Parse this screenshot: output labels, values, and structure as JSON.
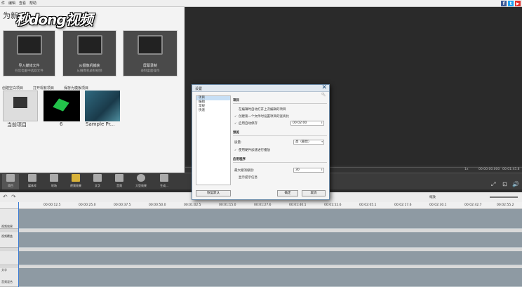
{
  "menubar": {
    "items": [
      "件",
      "编辑",
      "查看",
      "帮助"
    ]
  },
  "watermark": {
    "text": "秒dong视频"
  },
  "left_panel": {
    "title": "为新",
    "tiles": [
      {
        "line1": "导入媒体文件",
        "line2": "在您电脑中选取文件"
      },
      {
        "line1": "从摄像机捕获",
        "line2": "从摄像机录制视频"
      },
      {
        "line1": "屏幕录制",
        "line2": "录制桌面操作"
      }
    ],
    "links": [
      "创建空白项目",
      "打开现有项目",
      "保存为模板项目"
    ],
    "thumbs": [
      {
        "label": "当前项目"
      },
      {
        "label": "6"
      },
      {
        "label": "Sample Pr..."
      }
    ]
  },
  "preview": {
    "speed": "1x",
    "tc1": "00:00:00.000",
    "tc2": "00:01:45.8"
  },
  "toolbar": {
    "items": [
      "项目",
      "媒体库",
      "转场",
      "视频效果",
      "文字",
      "音频",
      "大型效果",
      "生成..."
    ]
  },
  "timeline": {
    "zoom_label": "缩放",
    "ruler": [
      "00:00:12.5",
      "00:00:25.0",
      "00:00:37.5",
      "00:00:50.0",
      "00:01:02.5",
      "00:01:15.0",
      "00:01:27.6",
      "00:01:40.1",
      "00:01:52.6",
      "00:02:05.1",
      "00:02:17.6",
      "00:02:30.1",
      "00:02:42.7",
      "00:02:55.2"
    ],
    "track_labels": [
      "视频效果",
      "视频覆盖",
      "",
      "文字",
      "音频混合"
    ]
  },
  "dialog": {
    "title": "设置",
    "close": "✕",
    "nav": [
      "项目",
      "编辑",
      "常规",
      "快速"
    ],
    "sections": {
      "project": "项目",
      "preview": "预览",
      "engine": "应用程序"
    },
    "rows": {
      "r1": "在编辑时自动打开上次编辑的项目",
      "r2": "创建第一个文件时设置项目的宽高比",
      "r3": "启用自动保存",
      "r3_value": "00:02:00",
      "quality_label": "质量:",
      "quality_value": "高（最佳）",
      "r5": "使用硬件加速进行播放",
      "undo_label": "最大撤消级别:",
      "undo_value": "30",
      "r7": "显示提示信息"
    },
    "buttons": {
      "reset": "恢复默认",
      "ok": "确定",
      "cancel": "取消"
    }
  },
  "colors": {
    "accent": "#3b7bd4",
    "twitter": "#1da1f2",
    "facebook": "#3b5998",
    "youtube": "#e52d27"
  }
}
